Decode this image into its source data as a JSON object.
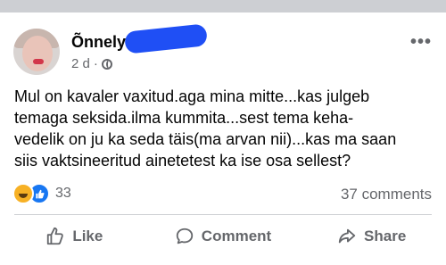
{
  "post": {
    "author": "Õnnely",
    "time": "2 d",
    "separator": "·",
    "privacy_icon": "globe-icon",
    "more_label": "•••",
    "text": "Mul on kavaler vaxitud.aga mina mitte...kas julgeb\ntemaga seksida.ilma kummita...sest tema keha-\nvedelik on ju ka seda täis(ma arvan nii)...kas ma saan\nsiis vaktsineeritud ainetetest  ka ise osa sellest?",
    "reactions_count": "33",
    "comments_label": "37 comments"
  },
  "actions": {
    "like": "Like",
    "comment": "Comment",
    "share": "Share"
  },
  "colors": {
    "meta": "#65676b",
    "like_blue": "#1877f2",
    "haha_yellow": "#f7b125",
    "redaction": "#1f4ff5"
  }
}
